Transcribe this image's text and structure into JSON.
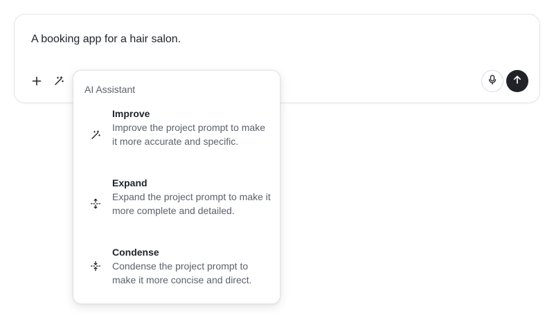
{
  "composer": {
    "prompt_text": "A booking app for a hair salon."
  },
  "toolbar": {
    "add_icon": "plus-icon",
    "magic_icon": "magic-wand-icon",
    "mic_icon": "microphone-icon",
    "send_icon": "arrow-up-icon"
  },
  "menu": {
    "title": "AI Assistant",
    "items": [
      {
        "label": "Improve",
        "description": "Improve the project prompt to make it more accurate and specific.",
        "icon": "magic-wand-icon"
      },
      {
        "label": "Expand",
        "description": "Expand the project prompt to make it more complete and detailed.",
        "icon": "expand-icon"
      },
      {
        "label": "Condense",
        "description": "Condense the project prompt to make it more concise and direct.",
        "icon": "condense-icon"
      }
    ]
  },
  "colors": {
    "primary_dark": "#1f2328",
    "muted_text": "#5b616b",
    "border": "#e3e4e8"
  }
}
